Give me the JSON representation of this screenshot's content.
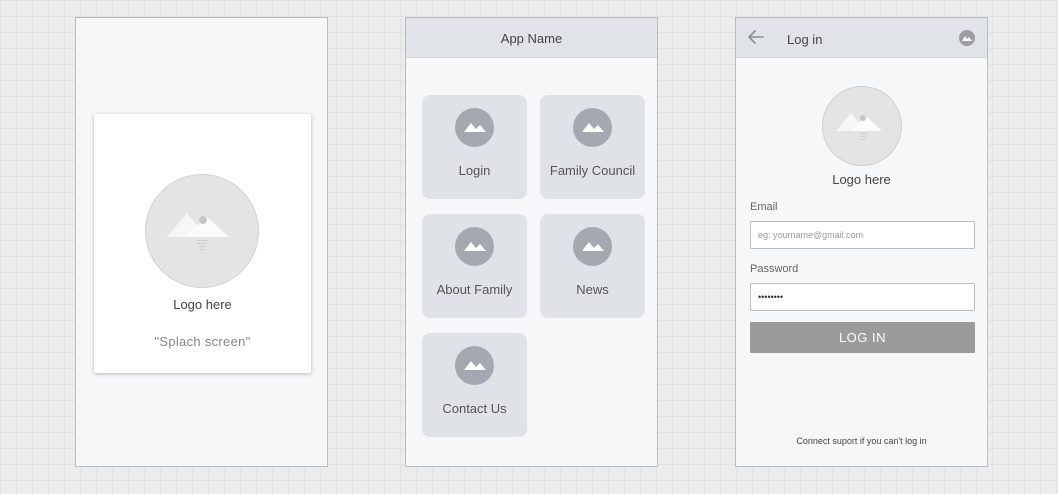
{
  "splash": {
    "logo_label": "Logo here",
    "subtitle": "\"Splach screen\""
  },
  "home": {
    "app_title": "App Name",
    "tiles": [
      {
        "label": "Login",
        "icon": "image-placeholder-icon"
      },
      {
        "label": "Family Council",
        "icon": "image-placeholder-icon"
      },
      {
        "label": "About Family",
        "icon": "image-placeholder-icon"
      },
      {
        "label": "News",
        "icon": "image-placeholder-icon"
      },
      {
        "label": "Contact Us",
        "icon": "image-placeholder-icon"
      }
    ]
  },
  "login": {
    "title": "Log in",
    "logo_label": "Logo here",
    "email_label": "Email",
    "email_placeholder": "eg: yourname@gmail.com",
    "email_value": "",
    "password_label": "Password",
    "password_value": "••••••••",
    "login_button": "LOG IN",
    "forgot_link": "Forgot your password?",
    "support_text": "Connect suport if you can't log in"
  },
  "colors": {
    "canvas": "#ececec",
    "screen_bg": "#f6f7f9",
    "app_bar": "#e0e3e8",
    "tile_bg": "#dfe2e7",
    "tile_icon": "#a4a8b1",
    "button": "#9b9b9b"
  }
}
